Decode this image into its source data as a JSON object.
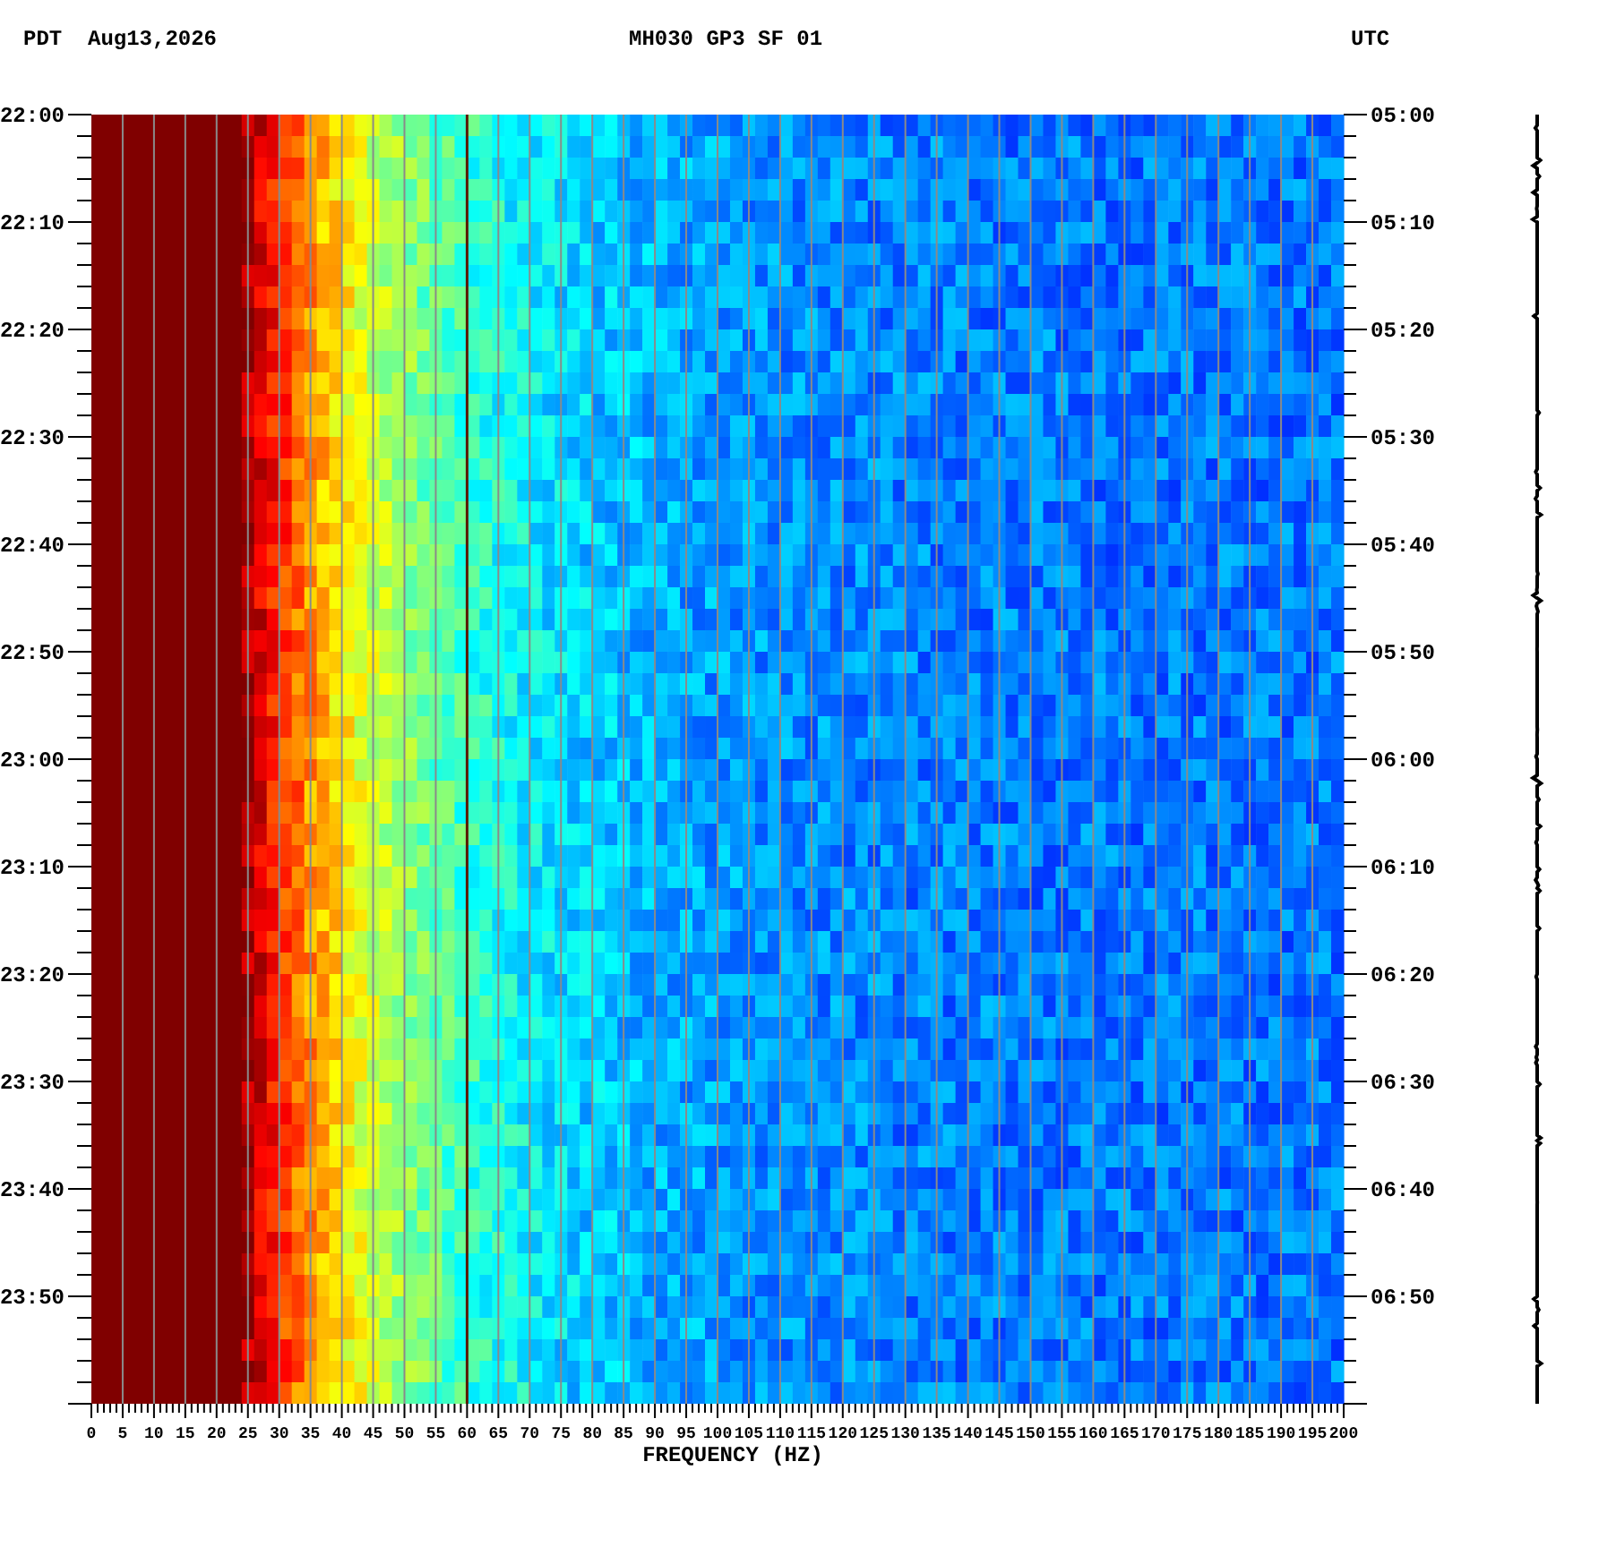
{
  "header": {
    "left_zone": "PDT",
    "date": "Aug13,2026",
    "station": "MH030 GP3 SF 01",
    "right_zone": "UTC"
  },
  "spectrogram": {
    "left_time_labels": [
      "22:00",
      "22:10",
      "22:20",
      "22:30",
      "22:40",
      "22:50",
      "23:00",
      "23:10",
      "23:20",
      "23:30",
      "23:40",
      "23:50"
    ],
    "right_time_labels": [
      "05:00",
      "05:10",
      "05:20",
      "05:30",
      "05:40",
      "05:50",
      "06:00",
      "06:10",
      "06:20",
      "06:30",
      "06:40",
      "06:50"
    ],
    "frequency_labels": [
      "0",
      "5",
      "10",
      "15",
      "20",
      "25",
      "30",
      "35",
      "40",
      "45",
      "50",
      "55",
      "60",
      "65",
      "70",
      "75",
      "80",
      "85",
      "90",
      "95",
      "100",
      "105",
      "110",
      "115",
      "120",
      "125",
      "130",
      "135",
      "140",
      "145",
      "150",
      "155",
      "160",
      "165",
      "170",
      "175",
      "180",
      "185",
      "190",
      "195",
      "200"
    ],
    "xlabel": "FREQUENCY (HZ)"
  }
}
